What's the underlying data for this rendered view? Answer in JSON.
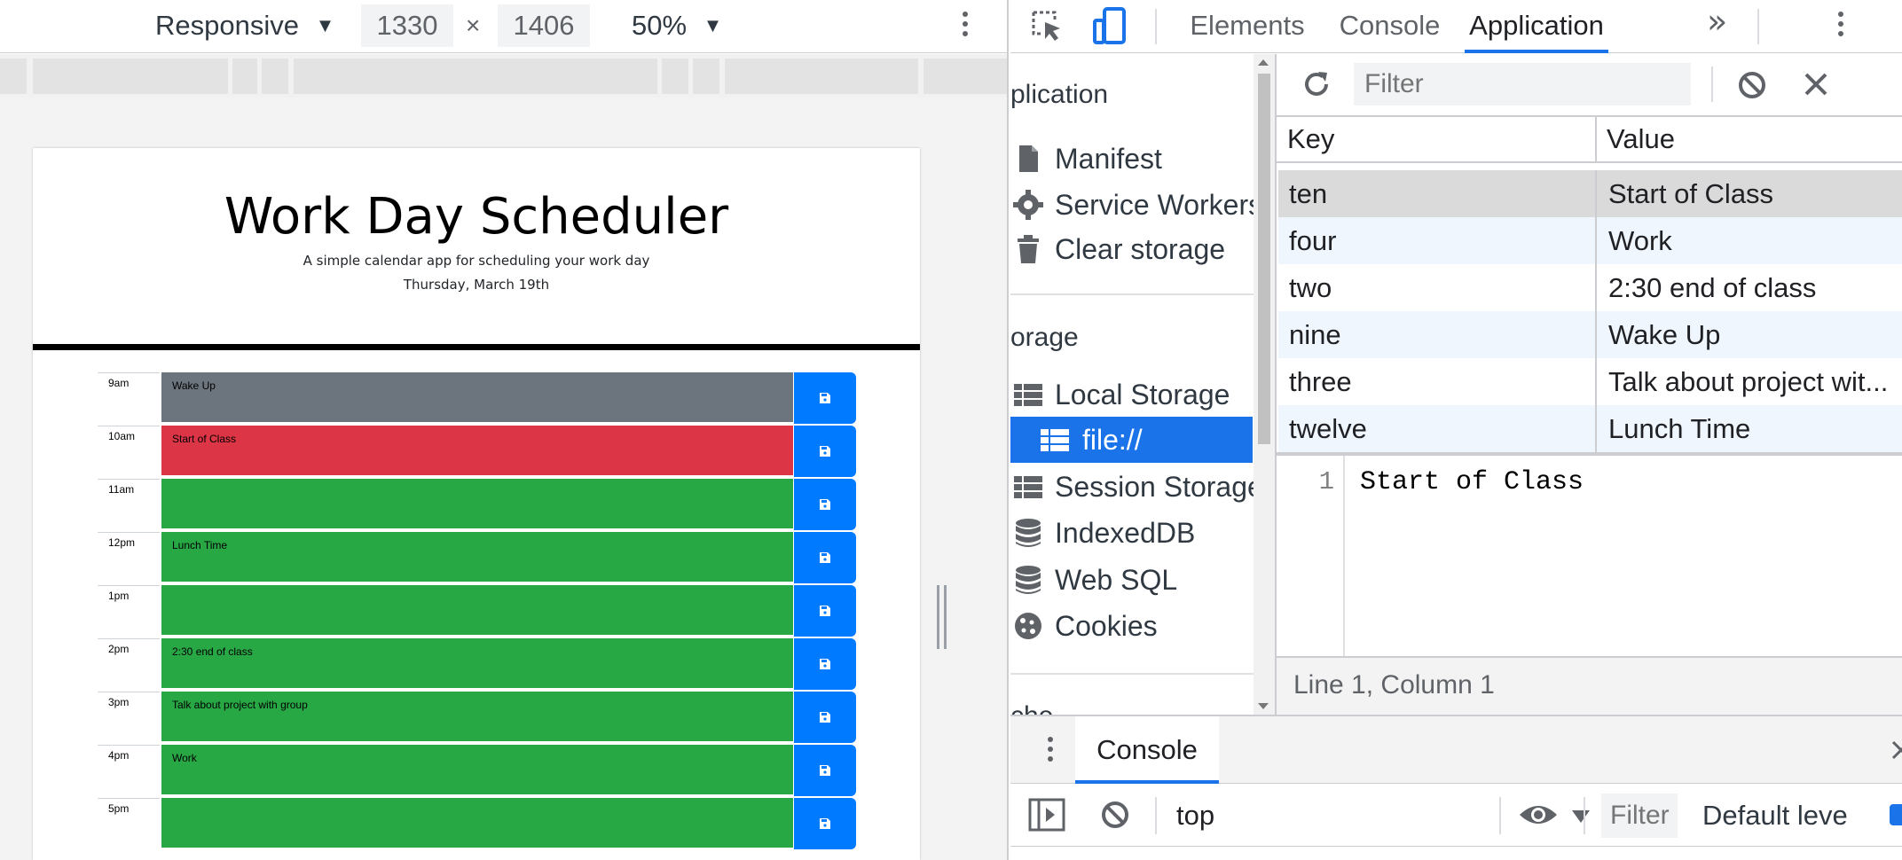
{
  "device_toolbar": {
    "mode_label": "Responsive",
    "mode_caret": "▼",
    "width": "1330",
    "times": "×",
    "height": "1406",
    "zoom": "50%",
    "zoom_caret": "▼"
  },
  "scheduler": {
    "title": "Work Day Scheduler",
    "subtitle": "A simple calendar app for scheduling your work day",
    "date": "Thursday, March 19th",
    "rows": [
      {
        "hour": "9am",
        "text": "Wake Up",
        "state": "past"
      },
      {
        "hour": "10am",
        "text": "Start of Class",
        "state": "present"
      },
      {
        "hour": "11am",
        "text": "",
        "state": "future"
      },
      {
        "hour": "12pm",
        "text": "Lunch Time",
        "state": "future"
      },
      {
        "hour": "1pm",
        "text": "",
        "state": "future"
      },
      {
        "hour": "2pm",
        "text": "2:30 end of class",
        "state": "future"
      },
      {
        "hour": "3pm",
        "text": "Talk about project with group",
        "state": "future"
      },
      {
        "hour": "4pm",
        "text": "Work",
        "state": "future"
      },
      {
        "hour": "5pm",
        "text": "",
        "state": "future"
      }
    ],
    "colors": {
      "past": "#6c757d",
      "present": "#dc3545",
      "future": "#28a745",
      "save": "#007bff"
    }
  },
  "devtools": {
    "tabs": [
      {
        "label": "Elements",
        "active": false
      },
      {
        "label": "Console",
        "active": false
      },
      {
        "label": "Application",
        "active": true
      }
    ],
    "more_tabs": "»",
    "accent": "#1a73e8",
    "sidebar": {
      "section_app": "plication",
      "app_items": [
        "Manifest",
        "Service Workers",
        "Clear storage"
      ],
      "section_storage": "orage",
      "storage_items": [
        "Local Storage",
        "file://",
        "Session Storage",
        "IndexedDB",
        "Web SQL",
        "Cookies"
      ],
      "section_cache": "che"
    },
    "filter_placeholder": "Filter",
    "table": {
      "headers": {
        "key": "Key",
        "value": "Value"
      },
      "rows": [
        {
          "key": "ten",
          "value": "Start of Class"
        },
        {
          "key": "four",
          "value": "Work"
        },
        {
          "key": "two",
          "value": "2:30 end of class"
        },
        {
          "key": "nine",
          "value": "Wake Up"
        },
        {
          "key": "three",
          "value": "Talk about project wit..."
        },
        {
          "key": "twelve",
          "value": "Lunch Time"
        }
      ]
    },
    "preview": {
      "line_number": "1",
      "content": "Start of Class",
      "status": "Line 1, Column 1"
    },
    "drawer": {
      "tab": "Console",
      "context": "top",
      "filter_placeholder": "Filter",
      "levels": "Default leve"
    }
  }
}
